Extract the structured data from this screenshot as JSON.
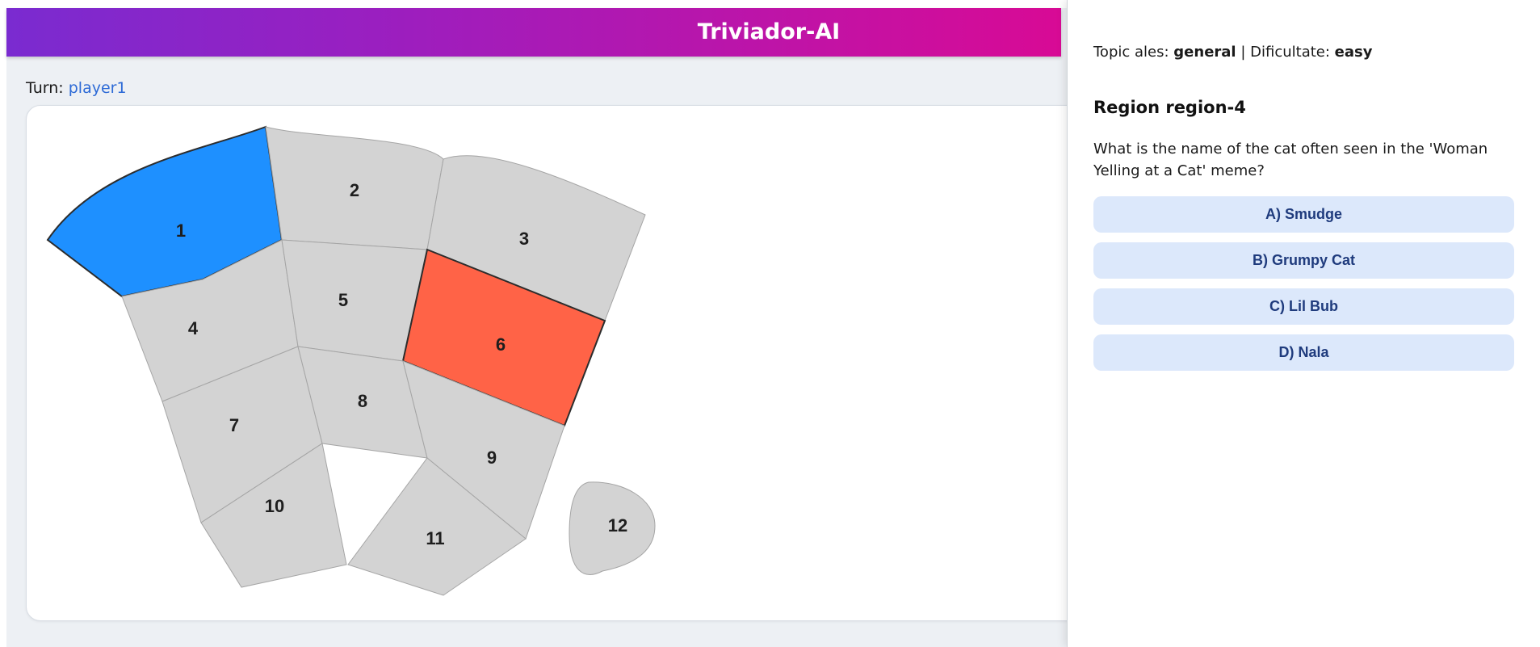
{
  "header": {
    "title": "Triviador-AI"
  },
  "turn": {
    "label": "Turn:",
    "player": "player1"
  },
  "board": {
    "regions": [
      {
        "label": "1",
        "state": "owned-player1",
        "color": "#1e90ff"
      },
      {
        "label": "2",
        "state": "neutral",
        "color": "#d3d3d3"
      },
      {
        "label": "3",
        "state": "neutral",
        "color": "#d3d3d3"
      },
      {
        "label": "4",
        "state": "neutral",
        "color": "#d3d3d3"
      },
      {
        "label": "5",
        "state": "neutral",
        "color": "#d3d3d3"
      },
      {
        "label": "6",
        "state": "highlighted",
        "color": "#ff6347"
      },
      {
        "label": "7",
        "state": "neutral",
        "color": "#d3d3d3"
      },
      {
        "label": "8",
        "state": "neutral",
        "color": "#d3d3d3"
      },
      {
        "label": "9",
        "state": "neutral",
        "color": "#d3d3d3"
      },
      {
        "label": "10",
        "state": "neutral",
        "color": "#d3d3d3"
      },
      {
        "label": "11",
        "state": "neutral",
        "color": "#d3d3d3"
      },
      {
        "label": "12",
        "state": "neutral",
        "color": "#d3d3d3"
      }
    ]
  },
  "panel": {
    "topic_label": "Topic ales:",
    "topic_value": "general",
    "separator": "|",
    "difficulty_label": "Dificultate:",
    "difficulty_value": "easy",
    "question_title": "Region region-4",
    "question_text": "What is the name of the cat often seen in the 'Woman Yelling at a Cat' meme?",
    "answers": [
      {
        "label": "A) Smudge"
      },
      {
        "label": "B) Grumpy Cat"
      },
      {
        "label": "C) Lil Bub"
      },
      {
        "label": "D) Nala"
      }
    ]
  },
  "colors": {
    "accent_gradient_start": "#7a2bd0",
    "accent_gradient_end": "#d80a95",
    "player1": "#1e90ff",
    "highlight": "#ff6347",
    "neutral": "#d3d3d3",
    "answer_bg": "#dce8fb",
    "answer_text": "#1f3b7d"
  }
}
